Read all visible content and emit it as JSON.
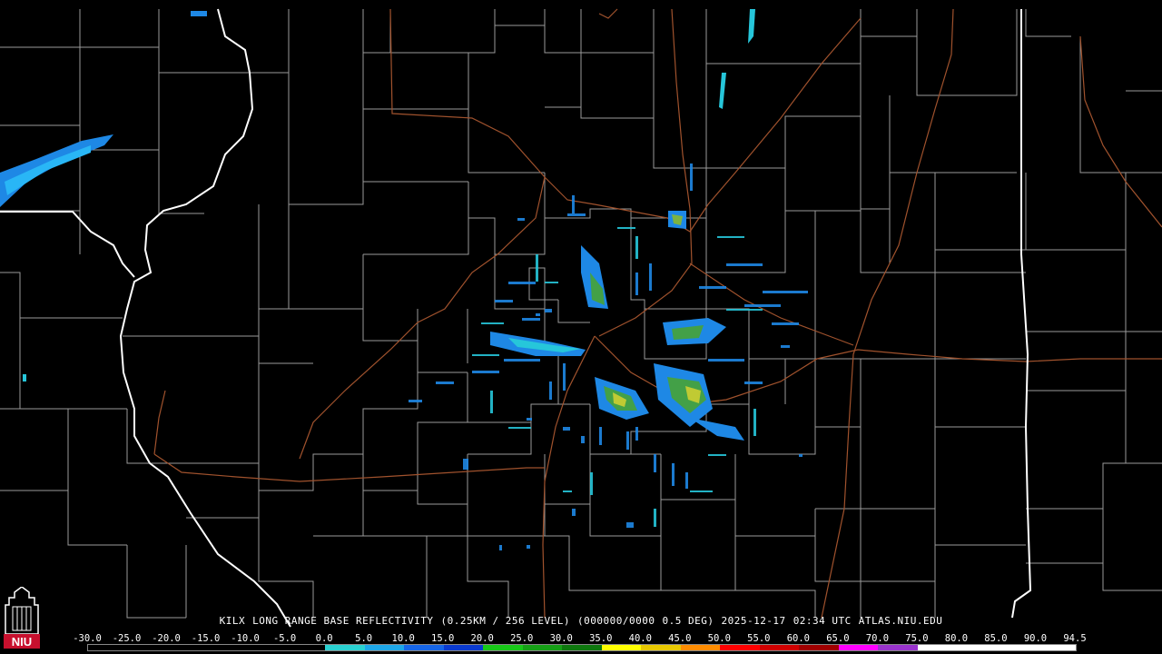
{
  "caption": {
    "station": "KILX",
    "product": "LONG RANGE BASE REFLECTIVITY",
    "resolution": "(0.25KM / 256 LEVEL)",
    "volume": "(000000/0000",
    "tilt": "0.5 DEG)",
    "date": "2025-12-17",
    "time": "02:34 UTC",
    "site": "ATLAS.NIU.EDU"
  },
  "logo": {
    "text": "NIU",
    "color": "#c8102e"
  },
  "color_scale": {
    "labels": [
      "-30.0",
      "-25.0",
      "-20.0",
      "-15.0",
      "-10.0",
      "-5.0",
      "0.0",
      "5.0",
      "10.0",
      "15.0",
      "20.0",
      "25.0",
      "30.0",
      "35.0",
      "40.0",
      "45.0",
      "50.0",
      "55.0",
      "60.0",
      "65.0",
      "70.0",
      "75.0",
      "80.0",
      "85.0",
      "90.0",
      "94.5"
    ],
    "colors": [
      "#000000",
      "#000000",
      "#000000",
      "#000000",
      "#000000",
      "#000000",
      "#2ad1d1",
      "#1ea7e8",
      "#1766e8",
      "#0a3ad0",
      "#18c818",
      "#16a016",
      "#0e780e",
      "#ffff00",
      "#e8c800",
      "#ff8c00",
      "#ff0000",
      "#d00000",
      "#a00000",
      "#ff00ff",
      "#9933cc",
      "#ffffff",
      "#ffffff",
      "#ffffff",
      "#ffffff"
    ]
  },
  "map": {
    "state_border_color": "#ffffff",
    "county_line_color": "#9a9a9a",
    "highway_color": "#a0522d",
    "radar_site_color": "#00bcd4"
  }
}
